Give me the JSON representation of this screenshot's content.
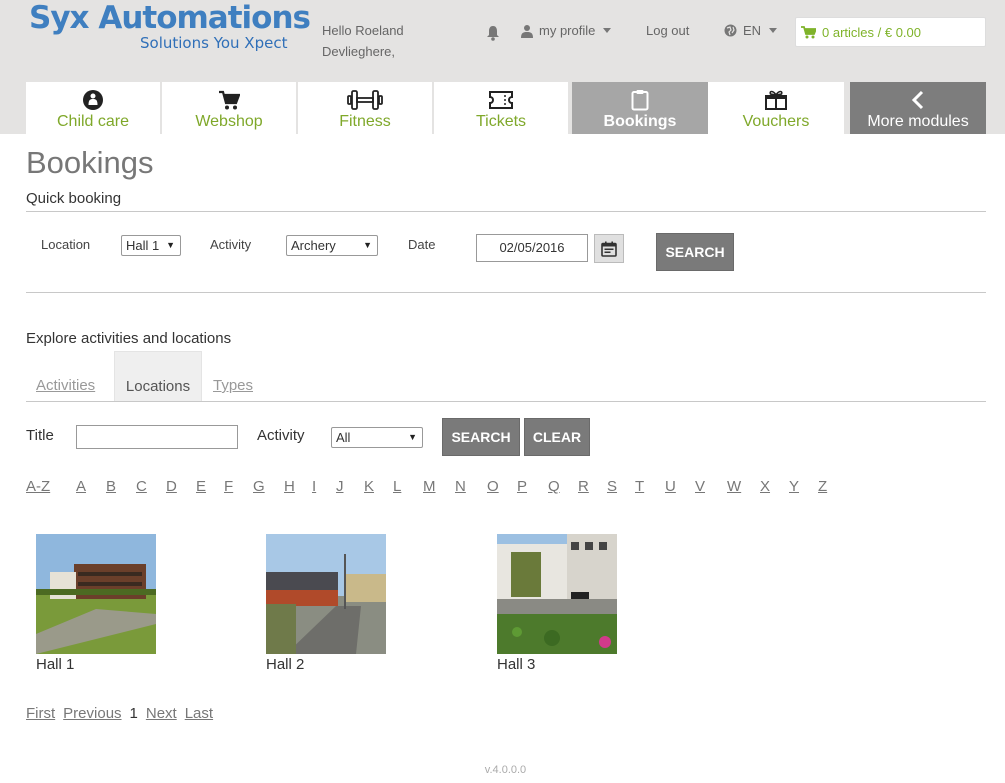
{
  "brand": {
    "title": "Syx Automations",
    "tagline": "Solutions You Xpect"
  },
  "header": {
    "greeting_line1": "Hello Roeland",
    "greeting_line2": "Devlieghere,",
    "profile_label": "my profile",
    "logout_label": "Log out",
    "language": "EN",
    "cart_label": "0 articles / € 0.00"
  },
  "nav": {
    "tabs": [
      {
        "label": "Child care",
        "icon": "child-care-icon"
      },
      {
        "label": "Webshop",
        "icon": "cart-icon"
      },
      {
        "label": "Fitness",
        "icon": "dumbbell-icon"
      },
      {
        "label": "Tickets",
        "icon": "ticket-icon"
      },
      {
        "label": "Bookings",
        "icon": "clipboard-icon",
        "active": true
      },
      {
        "label": "Vouchers",
        "icon": "gift-icon"
      },
      {
        "label": "More modules",
        "icon": "chevron-left-icon"
      }
    ]
  },
  "page": {
    "title": "Bookings"
  },
  "quick_booking": {
    "title": "Quick booking",
    "location_label": "Location",
    "location_value": "Hall 1",
    "activity_label": "Activity",
    "activity_value": "Archery",
    "date_label": "Date",
    "date_value": "02/05/2016",
    "search_label": "SEARCH"
  },
  "explore": {
    "title": "Explore activities and locations",
    "tabs": [
      "Activities",
      "Locations",
      "Types"
    ],
    "active_tab": "Locations",
    "title_label": "Title",
    "title_value": "",
    "activity_label": "Activity",
    "activity_value": "All",
    "search_label": "SEARCH",
    "clear_label": "CLEAR"
  },
  "alphabet": [
    "A-Z",
    "A",
    "B",
    "C",
    "D",
    "E",
    "F",
    "G",
    "H",
    "I",
    "J",
    "K",
    "L",
    "M",
    "N",
    "O",
    "P",
    "Q",
    "R",
    "S",
    "T",
    "U",
    "V",
    "W",
    "X",
    "Y",
    "Z"
  ],
  "locations": [
    {
      "name": "Hall 1"
    },
    {
      "name": "Hall 2"
    },
    {
      "name": "Hall 3"
    }
  ],
  "pagination": {
    "first": "First",
    "previous": "Previous",
    "current": "1",
    "next": "Next",
    "last": "Last"
  },
  "footer": {
    "version": "v.4.0.0.0"
  },
  "colors": {
    "brand_blue": "#3f7fc0",
    "nav_green": "#7fa82a",
    "cart_green": "#7fb32a",
    "active_tab": "#a6a6a6",
    "button_gray": "#7a7a7a"
  }
}
